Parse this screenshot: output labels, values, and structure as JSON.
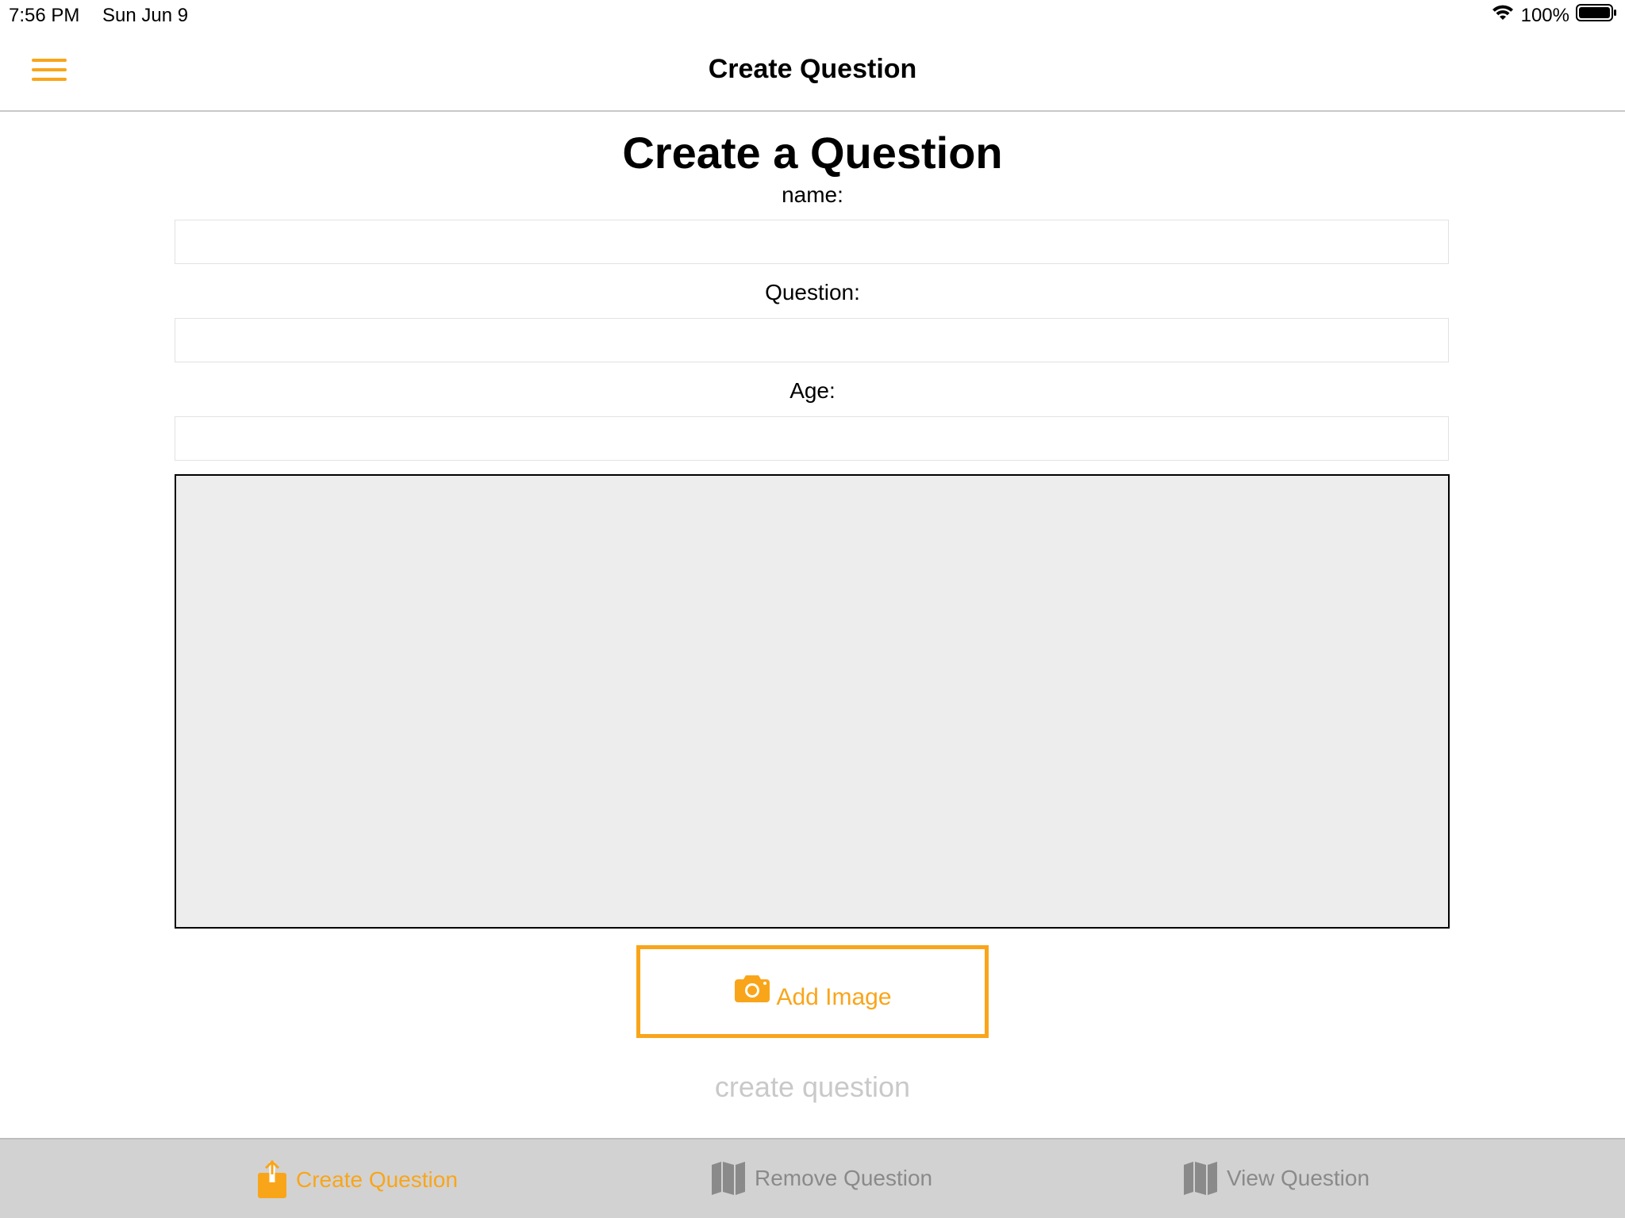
{
  "status_bar": {
    "time": "7:56 PM",
    "date": "Sun Jun 9",
    "battery": "100%",
    "icons": [
      "wifi-icon",
      "battery-icon"
    ]
  },
  "nav": {
    "title": "Create Question",
    "menu_icon": "hamburger-menu-icon"
  },
  "form": {
    "heading": "Create a Question",
    "name_label": "name:",
    "name_value": "",
    "question_label": "Question:",
    "question_value": "",
    "age_label": "Age:",
    "age_value": "",
    "add_image_label": "Add Image",
    "add_image_icon": "camera-icon",
    "submit_label": "create question"
  },
  "tab_bar": {
    "tabs": [
      {
        "label": "Create Question",
        "icon": "share-upload-icon",
        "active": true
      },
      {
        "label": "Remove Question",
        "icon": "map-icon",
        "active": false
      },
      {
        "label": "View Question",
        "icon": "map-icon",
        "active": false
      }
    ]
  },
  "colors": {
    "accent": "#f9a51a",
    "inactive": "#8a8a8a",
    "tab_bar_bg": "#d2d2d2",
    "image_placeholder_bg": "#ededed",
    "disabled_text": "#c9c9c9"
  }
}
